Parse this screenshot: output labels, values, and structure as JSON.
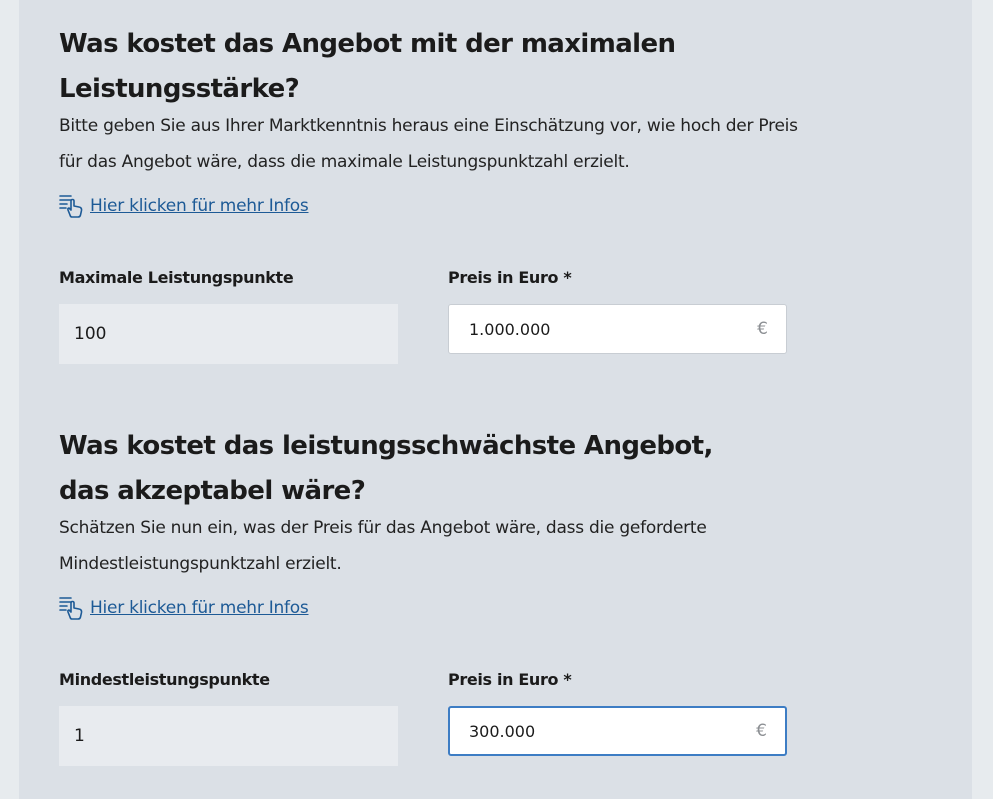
{
  "section1": {
    "title": "Was kostet das Angebot mit der maximalen Leistungsstärke?",
    "description": "Bitte geben Sie aus Ihrer Marktkenntnis heraus eine Einschätzung vor, wie hoch der Preis für das Angebot wäre, dass die maximale Leistungspunktzahl erzielt.",
    "info_link": "Hier klicken für mehr Infos",
    "points_label": "Maximale Leistungspunkte",
    "points_value": "100",
    "price_label": "Preis in Euro *",
    "price_value": "1.000.000",
    "currency": "€"
  },
  "section2": {
    "title": "Was kostet das leistungsschwächste Angebot, das akzeptabel wäre?",
    "description": "Schätzen Sie nun ein, was der Preis für das Angebot wäre, dass die geforderte Mindestleistungspunktzahl erzielt.",
    "info_link": "Hier klicken für mehr Infos",
    "points_label": "Mindestleistungspunkte",
    "points_value": "1",
    "price_label": "Preis in Euro *",
    "price_value": "300.000",
    "currency": "€"
  },
  "colors": {
    "panel_background": "#dbe0e6",
    "page_background": "#e7ebee",
    "link": "#1d5a96",
    "focus_border": "#3d7dc4"
  },
  "icons": {
    "info_link_icon": "hand-pointer-document-icon"
  }
}
